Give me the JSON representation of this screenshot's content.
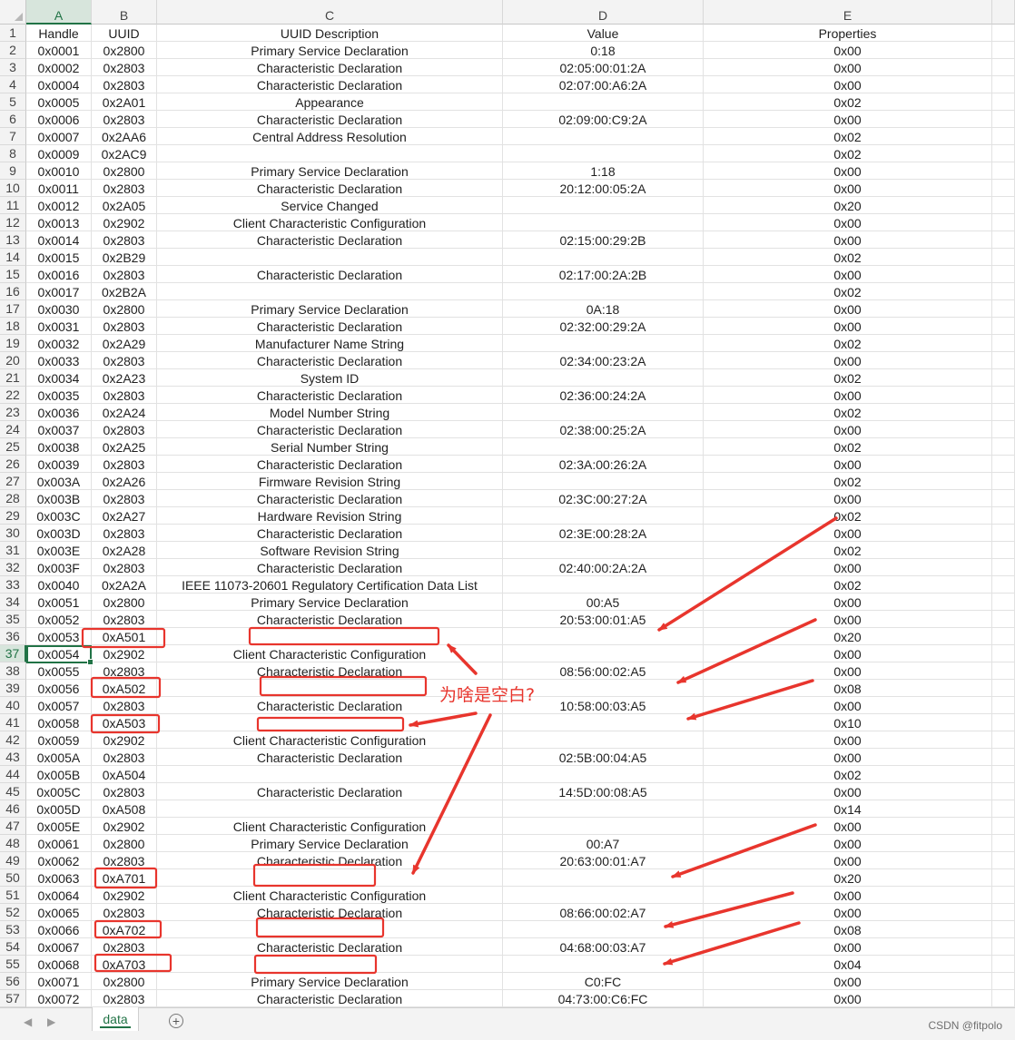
{
  "columns": [
    "A",
    "B",
    "C",
    "D",
    "E"
  ],
  "selected_column": "A",
  "selected_row": 37,
  "rows": [
    [
      "1",
      "Handle",
      "UUID",
      "UUID Description",
      "Value",
      "Properties"
    ],
    [
      "2",
      "0x0001",
      "0x2800",
      "Primary Service Declaration",
      "0:18",
      "0x00"
    ],
    [
      "3",
      "0x0002",
      "0x2803",
      "Characteristic Declaration",
      "02:05:00:01:2A",
      "0x00"
    ],
    [
      "4",
      "0x0004",
      "0x2803",
      "Characteristic Declaration",
      "02:07:00:A6:2A",
      "0x00"
    ],
    [
      "5",
      "0x0005",
      "0x2A01",
      "Appearance",
      "",
      "0x02"
    ],
    [
      "6",
      "0x0006",
      "0x2803",
      "Characteristic Declaration",
      "02:09:00:C9:2A",
      "0x00"
    ],
    [
      "7",
      "0x0007",
      "0x2AA6",
      "Central Address Resolution",
      "",
      "0x02"
    ],
    [
      "8",
      "0x0009",
      "0x2AC9",
      "",
      "",
      "0x02"
    ],
    [
      "9",
      "0x0010",
      "0x2800",
      "Primary Service Declaration",
      "1:18",
      "0x00"
    ],
    [
      "10",
      "0x0011",
      "0x2803",
      "Characteristic Declaration",
      "20:12:00:05:2A",
      "0x00"
    ],
    [
      "11",
      "0x0012",
      "0x2A05",
      "Service Changed",
      "",
      "0x20"
    ],
    [
      "12",
      "0x0013",
      "0x2902",
      "Client Characteristic Configuration",
      "",
      "0x00"
    ],
    [
      "13",
      "0x0014",
      "0x2803",
      "Characteristic Declaration",
      "02:15:00:29:2B",
      "0x00"
    ],
    [
      "14",
      "0x0015",
      "0x2B29",
      "",
      "",
      "0x02"
    ],
    [
      "15",
      "0x0016",
      "0x2803",
      "Characteristic Declaration",
      "02:17:00:2A:2B",
      "0x00"
    ],
    [
      "16",
      "0x0017",
      "0x2B2A",
      "",
      "",
      "0x02"
    ],
    [
      "17",
      "0x0030",
      "0x2800",
      "Primary Service Declaration",
      "0A:18",
      "0x00"
    ],
    [
      "18",
      "0x0031",
      "0x2803",
      "Characteristic Declaration",
      "02:32:00:29:2A",
      "0x00"
    ],
    [
      "19",
      "0x0032",
      "0x2A29",
      "Manufacturer Name String",
      "",
      "0x02"
    ],
    [
      "20",
      "0x0033",
      "0x2803",
      "Characteristic Declaration",
      "02:34:00:23:2A",
      "0x00"
    ],
    [
      "21",
      "0x0034",
      "0x2A23",
      "System ID",
      "",
      "0x02"
    ],
    [
      "22",
      "0x0035",
      "0x2803",
      "Characteristic Declaration",
      "02:36:00:24:2A",
      "0x00"
    ],
    [
      "23",
      "0x0036",
      "0x2A24",
      "Model Number String",
      "",
      "0x02"
    ],
    [
      "24",
      "0x0037",
      "0x2803",
      "Characteristic Declaration",
      "02:38:00:25:2A",
      "0x00"
    ],
    [
      "25",
      "0x0038",
      "0x2A25",
      "Serial Number String",
      "",
      "0x02"
    ],
    [
      "26",
      "0x0039",
      "0x2803",
      "Characteristic Declaration",
      "02:3A:00:26:2A",
      "0x00"
    ],
    [
      "27",
      "0x003A",
      "0x2A26",
      "Firmware Revision String",
      "",
      "0x02"
    ],
    [
      "28",
      "0x003B",
      "0x2803",
      "Characteristic Declaration",
      "02:3C:00:27:2A",
      "0x00"
    ],
    [
      "29",
      "0x003C",
      "0x2A27",
      "Hardware Revision String",
      "",
      "0x02"
    ],
    [
      "30",
      "0x003D",
      "0x2803",
      "Characteristic Declaration",
      "02:3E:00:28:2A",
      "0x00"
    ],
    [
      "31",
      "0x003E",
      "0x2A28",
      "Software Revision String",
      "",
      "0x02"
    ],
    [
      "32",
      "0x003F",
      "0x2803",
      "Characteristic Declaration",
      "02:40:00:2A:2A",
      "0x00"
    ],
    [
      "33",
      "0x0040",
      "0x2A2A",
      "IEEE 11073-20601 Regulatory Certification Data List",
      "",
      "0x02"
    ],
    [
      "34",
      "0x0051",
      "0x2800",
      "Primary Service Declaration",
      "00:A5",
      "0x00"
    ],
    [
      "35",
      "0x0052",
      "0x2803",
      "Characteristic Declaration",
      "20:53:00:01:A5",
      "0x00"
    ],
    [
      "36",
      "0x0053",
      "0xA501",
      "",
      "",
      "0x20"
    ],
    [
      "37",
      "0x0054",
      "0x2902",
      "Client Characteristic Configuration",
      "",
      "0x00"
    ],
    [
      "38",
      "0x0055",
      "0x2803",
      "Characteristic Declaration",
      "08:56:00:02:A5",
      "0x00"
    ],
    [
      "39",
      "0x0056",
      "0xA502",
      "",
      "",
      "0x08"
    ],
    [
      "40",
      "0x0057",
      "0x2803",
      "Characteristic Declaration",
      "10:58:00:03:A5",
      "0x00"
    ],
    [
      "41",
      "0x0058",
      "0xA503",
      "",
      "",
      "0x10"
    ],
    [
      "42",
      "0x0059",
      "0x2902",
      "Client Characteristic Configuration",
      "",
      "0x00"
    ],
    [
      "43",
      "0x005A",
      "0x2803",
      "Characteristic Declaration",
      "02:5B:00:04:A5",
      "0x00"
    ],
    [
      "44",
      "0x005B",
      "0xA504",
      "",
      "",
      "0x02"
    ],
    [
      "45",
      "0x005C",
      "0x2803",
      "Characteristic Declaration",
      "14:5D:00:08:A5",
      "0x00"
    ],
    [
      "46",
      "0x005D",
      "0xA508",
      "",
      "",
      "0x14"
    ],
    [
      "47",
      "0x005E",
      "0x2902",
      "Client Characteristic Configuration",
      "",
      "0x00"
    ],
    [
      "48",
      "0x0061",
      "0x2800",
      "Primary Service Declaration",
      "00:A7",
      "0x00"
    ],
    [
      "49",
      "0x0062",
      "0x2803",
      "Characteristic Declaration",
      "20:63:00:01:A7",
      "0x00"
    ],
    [
      "50",
      "0x0063",
      "0xA701",
      "",
      "",
      "0x20"
    ],
    [
      "51",
      "0x0064",
      "0x2902",
      "Client Characteristic Configuration",
      "",
      "0x00"
    ],
    [
      "52",
      "0x0065",
      "0x2803",
      "Characteristic Declaration",
      "08:66:00:02:A7",
      "0x00"
    ],
    [
      "53",
      "0x0066",
      "0xA702",
      "",
      "",
      "0x08"
    ],
    [
      "54",
      "0x0067",
      "0x2803",
      "Characteristic Declaration",
      "04:68:00:03:A7",
      "0x00"
    ],
    [
      "55",
      "0x0068",
      "0xA703",
      "",
      "",
      "0x04"
    ],
    [
      "56",
      "0x0071",
      "0x2800",
      "Primary Service Declaration",
      "C0:FC",
      "0x00"
    ],
    [
      "57",
      "0x0072",
      "0x2803",
      "Characteristic Declaration",
      "04:73:00:C6:FC",
      "0x00"
    ]
  ],
  "annotation": {
    "text": "为啥是空白?",
    "color": "#e8352d"
  },
  "sheet_tabs": [
    {
      "label": "data",
      "active": true
    }
  ],
  "nav_prev": "◀",
  "nav_next": "▶",
  "add_sheet_label": "+",
  "watermark": "CSDN @fitpolo",
  "colors": {
    "excel_green": "#217346",
    "header_bg": "#f3f3f3",
    "grid": "#e2e2e2",
    "annotation_red": "#e8352d"
  }
}
